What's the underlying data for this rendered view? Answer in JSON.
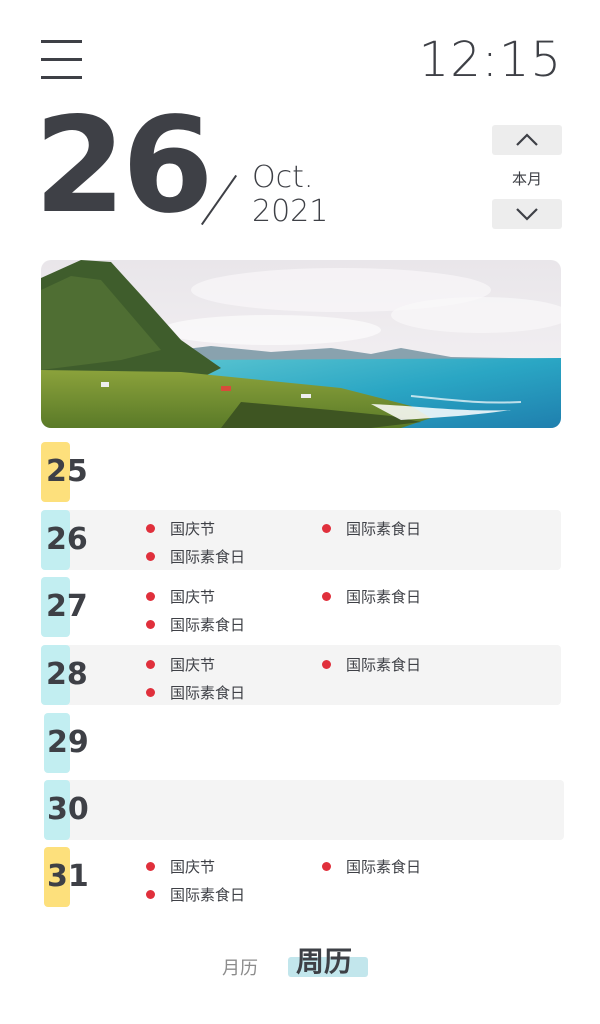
{
  "header": {
    "menu_icon": "hamburger-menu-icon",
    "time": "12:15"
  },
  "date": {
    "day": "26",
    "month": "Oct.",
    "year": "2021"
  },
  "month_nav": {
    "up_icon": "chevron-up-icon",
    "label": "本月",
    "down_icon": "chevron-down-icon"
  },
  "banner": {
    "image": "coastal-landscape-photo"
  },
  "days": [
    {
      "num": "25",
      "events": []
    },
    {
      "num": "26",
      "events": [
        "国庆节",
        "国际素食日",
        "国际素食日"
      ]
    },
    {
      "num": "27",
      "events": [
        "国庆节",
        "国际素食日",
        "国际素食日"
      ]
    },
    {
      "num": "28",
      "events": [
        "国庆节",
        "国际素食日",
        "国际素食日"
      ]
    },
    {
      "num": "29",
      "events": []
    },
    {
      "num": "30",
      "events": []
    },
    {
      "num": "31",
      "events": [
        "国庆节",
        "国际素食日",
        "国际素食日"
      ]
    }
  ],
  "colors": {
    "weekend_tab": "#fde07c",
    "weekday_tab": "#c2eef1",
    "event_dot": "#e0303c",
    "active_tab_highlight": "#c2e6ec"
  },
  "bottom_tabs": {
    "month": "月历",
    "week": "周历",
    "active": "周历"
  }
}
